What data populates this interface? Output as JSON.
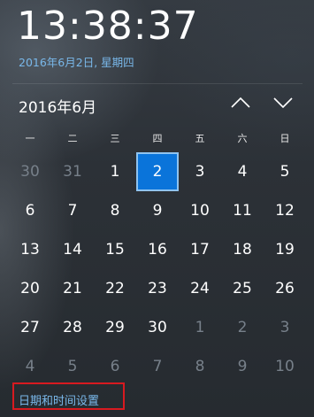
{
  "clock": {
    "time": "13:38:37"
  },
  "header": {
    "date_text": "2016年6月2日, 星期四"
  },
  "calendar": {
    "month_title": "2016年6月",
    "weekdays": [
      "一",
      "二",
      "三",
      "四",
      "五",
      "六",
      "日"
    ],
    "today": "2",
    "accent_color": "#0a74da",
    "weeks": [
      [
        {
          "d": "30",
          "dim": true
        },
        {
          "d": "31",
          "dim": true
        },
        {
          "d": "1",
          "dim": false
        },
        {
          "d": "2",
          "dim": false,
          "today": true
        },
        {
          "d": "3",
          "dim": false
        },
        {
          "d": "4",
          "dim": false
        },
        {
          "d": "5",
          "dim": false
        }
      ],
      [
        {
          "d": "6",
          "dim": false
        },
        {
          "d": "7",
          "dim": false
        },
        {
          "d": "8",
          "dim": false
        },
        {
          "d": "9",
          "dim": false
        },
        {
          "d": "10",
          "dim": false
        },
        {
          "d": "11",
          "dim": false
        },
        {
          "d": "12",
          "dim": false
        }
      ],
      [
        {
          "d": "13",
          "dim": false
        },
        {
          "d": "14",
          "dim": false
        },
        {
          "d": "15",
          "dim": false
        },
        {
          "d": "16",
          "dim": false
        },
        {
          "d": "17",
          "dim": false
        },
        {
          "d": "18",
          "dim": false
        },
        {
          "d": "19",
          "dim": false
        }
      ],
      [
        {
          "d": "20",
          "dim": false
        },
        {
          "d": "21",
          "dim": false
        },
        {
          "d": "22",
          "dim": false
        },
        {
          "d": "23",
          "dim": false
        },
        {
          "d": "24",
          "dim": false
        },
        {
          "d": "25",
          "dim": false
        },
        {
          "d": "26",
          "dim": false
        }
      ],
      [
        {
          "d": "27",
          "dim": false
        },
        {
          "d": "28",
          "dim": false
        },
        {
          "d": "29",
          "dim": false
        },
        {
          "d": "30",
          "dim": false
        },
        {
          "d": "1",
          "dim": true
        },
        {
          "d": "2",
          "dim": true
        },
        {
          "d": "3",
          "dim": true
        }
      ],
      [
        {
          "d": "4",
          "dim": true
        },
        {
          "d": "5",
          "dim": true
        },
        {
          "d": "6",
          "dim": true
        },
        {
          "d": "7",
          "dim": true
        },
        {
          "d": "8",
          "dim": true
        },
        {
          "d": "9",
          "dim": true
        },
        {
          "d": "10",
          "dim": true
        }
      ]
    ],
    "nav": {
      "prev_icon": "chevron-up-icon",
      "next_icon": "chevron-down-icon"
    }
  },
  "footer": {
    "settings_link": "日期和时间设置",
    "highlight_color": "#d71a20"
  }
}
